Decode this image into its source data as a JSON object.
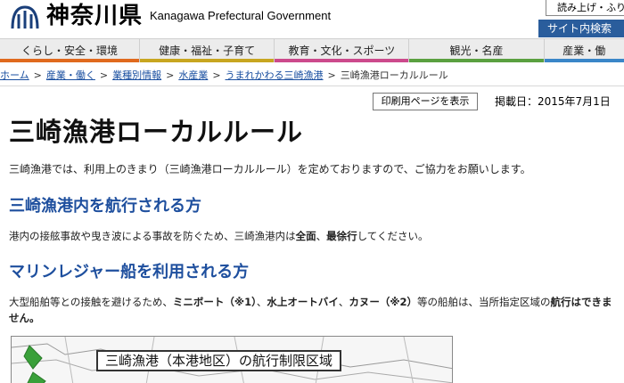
{
  "header": {
    "logo_jp": "神奈川県",
    "logo_en": "Kanagawa Prefectural Government",
    "readout_label": "読み上げ・ふり",
    "site_search_label": "サイト内検索"
  },
  "nav": {
    "items": [
      {
        "label": "くらし・安全・環境"
      },
      {
        "label": "健康・福祉・子育て"
      },
      {
        "label": "教育・文化・スポーツ"
      },
      {
        "label": "観光・名産"
      },
      {
        "label": "産業・働"
      }
    ]
  },
  "breadcrumb": {
    "items": [
      {
        "label": "ホーム"
      },
      {
        "label": "産業・働く"
      },
      {
        "label": "業種別情報"
      },
      {
        "label": "水産業"
      },
      {
        "label": "うまれかわる三崎漁港"
      },
      {
        "label": "三崎漁港ローカルルール"
      }
    ],
    "separator": ">"
  },
  "tools": {
    "print_label": "印刷用ページを表示",
    "posted_date": "掲載日：2015年7月1日"
  },
  "content": {
    "title": "三崎漁港ローカルルール",
    "intro": "三崎漁港では、利用上のきまり（三崎漁港ローカルルール）を定めておりますので、ご協力をお願いします。",
    "section1": {
      "heading": "三崎漁港内を航行される方",
      "text_before": "港内の接舷事故や曳き波による事故を防ぐため、三崎漁港内は",
      "bold1": "全面",
      "text_mid": "、",
      "bold2": "最徐行",
      "text_after": "してください。"
    },
    "section2": {
      "heading": "マリンレジャー船を利用される方",
      "text1": "大型船舶等との接触を避けるため、",
      "bold1": "ミニボート（※1）",
      "text2": "、",
      "bold2": "水上オートバイ",
      "text3": "、",
      "bold3": "カヌー（※2）",
      "text4": "等の船舶は、当所指定区域の",
      "bold4": "航行はできません。"
    },
    "map_title": "三崎漁港（本港地区）の航行制限区域"
  },
  "colors": {
    "brand_blue": "#2a5d9c",
    "heading_blue": "#1e4f9e",
    "link_blue": "#1a4fa0",
    "nav_lifestyle": "#e06a1e",
    "nav_health": "#c8a620",
    "nav_education": "#cc4a8c",
    "nav_tourism": "#5aa040",
    "nav_industry": "#3a86c8"
  },
  "icons": {
    "logo": "kanagawa-emblem-icon"
  }
}
